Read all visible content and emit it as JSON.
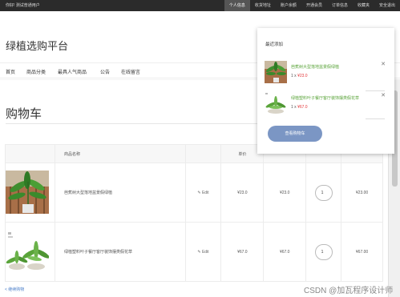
{
  "topbar": {
    "greeting": "你好! 测试普通用户",
    "items": [
      {
        "label": "个人信息",
        "active": true
      },
      {
        "label": "收货地址"
      },
      {
        "label": "账户余额"
      },
      {
        "label": "开通会员"
      },
      {
        "label": "订单信息"
      },
      {
        "label": "收藏夹"
      },
      {
        "label": "安全退出"
      }
    ]
  },
  "header": {
    "site_title": "绿植选购平台",
    "nav": [
      "首页",
      "商品分类",
      "最具人气商品",
      "公告",
      "在线留言"
    ]
  },
  "cart": {
    "title": "购物车",
    "columns": [
      "",
      "商品名称",
      "",
      "单价",
      "",
      "",
      ""
    ],
    "rows": [
      {
        "name": "芭蕉树大型落地盆景假绿植",
        "edit": "Edit",
        "price": "¥23.0",
        "subtotal": "¥23.0",
        "qty": "1",
        "total": "¥23.00"
      },
      {
        "name": "绿植塑料叶子餐厅客厅装饰摆类假花草",
        "edit": "Edit",
        "price": "¥67.0",
        "subtotal": "¥67.0",
        "qty": "1",
        "total": "¥67.00"
      }
    ],
    "continue_label": "< 继续购物"
  },
  "popover": {
    "title": "最近添加",
    "items": [
      {
        "name": "芭蕉树大型落地盆景假绿植",
        "qty_prefix": "1 x",
        "price": "¥23.0"
      },
      {
        "name": "绿植塑料叶子餐厅客厅装饰摆类假花草",
        "qty_prefix": "1 x",
        "price": "¥67.0"
      }
    ],
    "button_label": "查看购物车"
  },
  "watermark": "CSDN @加瓦程序设计师",
  "colors": {
    "topbar_bg": "#2b2b2b",
    "product_link": "#5aa43a",
    "price_red": "#e4393c",
    "button_blue": "#7b96c4",
    "link_blue": "#4a7ec9"
  }
}
